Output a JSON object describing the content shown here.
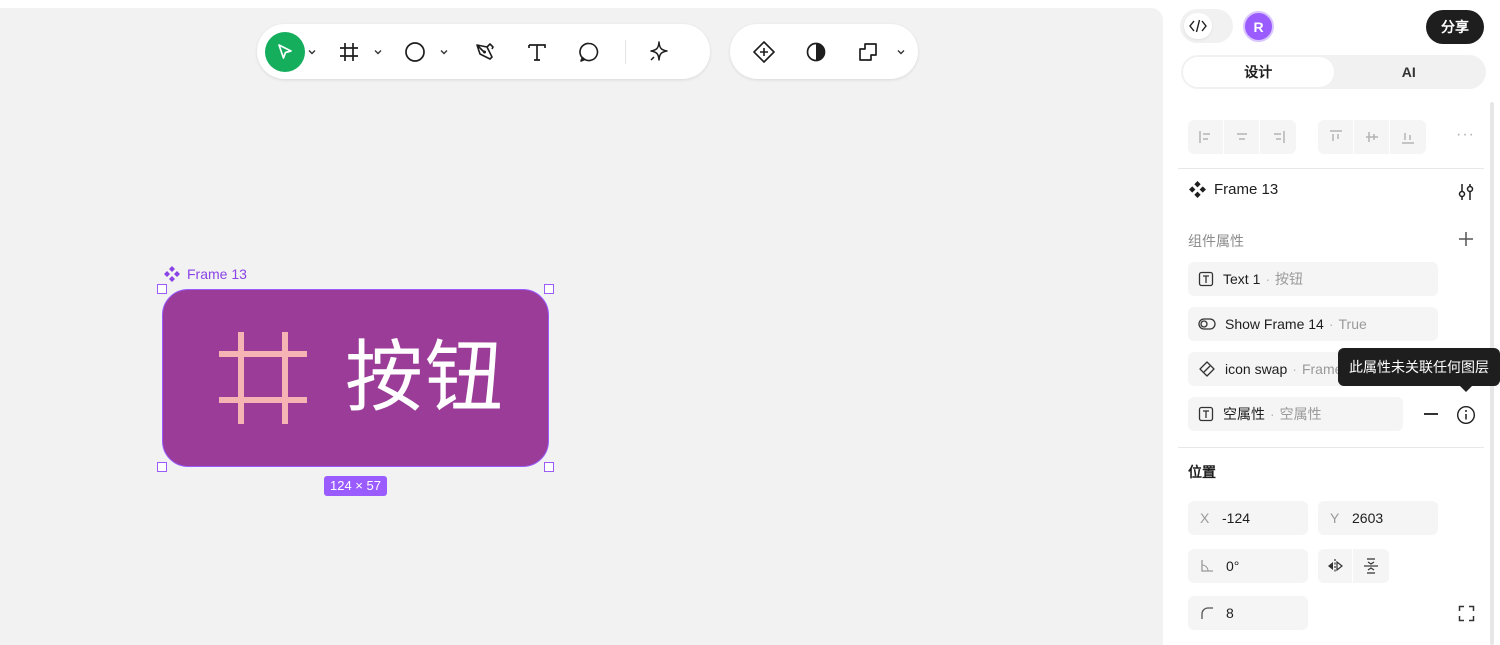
{
  "canvas": {
    "frame": {
      "label": "Frame 13",
      "text": "按钮",
      "size_badge": "124 × 57",
      "fill_color": "#9b3d98",
      "icon_color": "#f5b3b3"
    }
  },
  "toolbar": {
    "tools": [
      {
        "name": "move",
        "icon": "cursor-icon",
        "active": true,
        "has_dropdown": true
      },
      {
        "name": "frame",
        "icon": "frame-hash-icon",
        "has_dropdown": true
      },
      {
        "name": "shape",
        "icon": "ellipse-icon",
        "has_dropdown": true
      },
      {
        "name": "pen",
        "icon": "pen-icon"
      },
      {
        "name": "text",
        "icon": "text-icon"
      },
      {
        "name": "comment",
        "icon": "comment-icon"
      },
      {
        "name": "ai",
        "icon": "sparkle-icon"
      }
    ],
    "right_tools": [
      {
        "name": "component",
        "icon": "component-icon"
      },
      {
        "name": "mask",
        "icon": "half-circle-icon"
      },
      {
        "name": "boolean",
        "icon": "boolean-icon",
        "has_dropdown": true
      }
    ],
    "accent_color": "#14ae5c"
  },
  "header": {
    "avatar_initial": "R",
    "avatar_color": "#9a5cff",
    "share_label": "分享"
  },
  "tabs": [
    {
      "label": "设计",
      "active": true
    },
    {
      "label": "AI",
      "active": false
    }
  ],
  "component": {
    "title": "Frame 13",
    "properties_label": "组件属性",
    "properties": [
      {
        "icon": "text-prop-icon",
        "name": "Text 1",
        "value": "按钮"
      },
      {
        "icon": "toggle-prop-icon",
        "name": "Show Frame 14",
        "value": "True"
      },
      {
        "icon": "swap-prop-icon",
        "name": "icon swap",
        "value": "Frame"
      },
      {
        "icon": "text-prop-icon",
        "name": "空属性",
        "value": "空属性"
      }
    ],
    "tooltip": "此属性未关联任何图层"
  },
  "position": {
    "label": "位置",
    "x_prefix": "X",
    "x": "-124",
    "y_prefix": "Y",
    "y": "2603",
    "rotation": "0°",
    "radius": "8"
  }
}
